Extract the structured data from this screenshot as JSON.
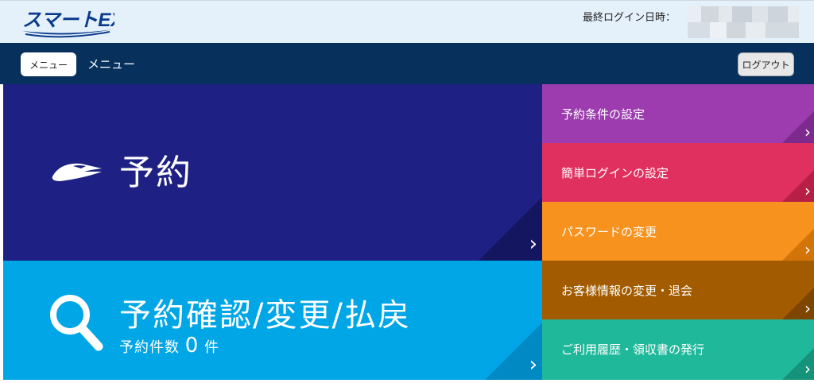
{
  "header": {
    "logo_text": "スマートEX",
    "last_login_label": "最終ログイン日時：",
    "colors": {
      "bg": "#e4f0fa",
      "logo": "#0a3a8c"
    }
  },
  "navbar": {
    "menu_button": "メニュー",
    "title": "メニュー",
    "logout_button": "ログアウト",
    "colors": {
      "bg": "#07305c"
    }
  },
  "main": {
    "reserve": {
      "label": "予約",
      "icon": "train-icon",
      "color": "#1e2183"
    },
    "confirm": {
      "label": "予約確認/変更/払戻",
      "count_prefix": "予約件数",
      "count_value": "0",
      "count_suffix": "件",
      "icon": "search-icon",
      "color": "#00a6e6"
    }
  },
  "side_menu": [
    {
      "label": "予約条件の設定",
      "color": "#9c3caf"
    },
    {
      "label": "簡単ログインの設定",
      "color": "#e0305f"
    },
    {
      "label": "パスワードの変更",
      "color": "#f7921e"
    },
    {
      "label": "お客様情報の変更・退会",
      "color": "#a35b00"
    },
    {
      "label": "ご利用履歴・領収書の発行",
      "color": "#1fb89a"
    }
  ],
  "icons": {
    "chevron": "chevron-right-icon"
  }
}
